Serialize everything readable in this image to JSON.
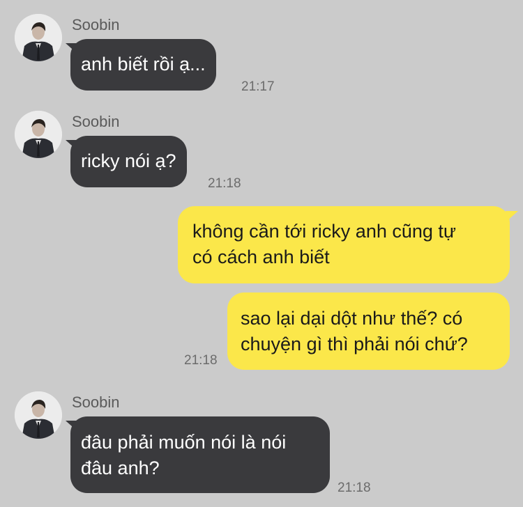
{
  "messages": [
    {
      "sender": "Soobin",
      "text": [
        "anh biết rồi ạ..."
      ],
      "time": "21:17"
    },
    {
      "sender": "Soobin",
      "text": [
        "ricky nói ạ?"
      ],
      "time": "21:18"
    },
    {
      "text": [
        "không cần tới ricky anh cũng tự",
        "có cách anh biết"
      ]
    },
    {
      "text": [
        "sao lại dại dột như thế? có",
        "chuyện gì thì phải nói chứ?"
      ],
      "time": "21:18"
    },
    {
      "sender": "Soobin",
      "text": [
        "đâu phải muốn nói là nói",
        "đâu anh?"
      ],
      "time": "21:18"
    }
  ],
  "colors": {
    "background": "#cbcbcb",
    "incoming_bubble": "#3a3a3d",
    "outgoing_bubble": "#fbe74a"
  },
  "icons": {
    "avatar": "profile-photo"
  }
}
